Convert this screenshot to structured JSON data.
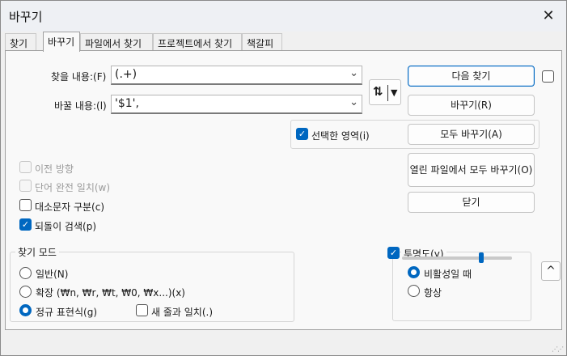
{
  "window": {
    "title": "바꾸기",
    "close_glyph": "✕"
  },
  "tabs": [
    {
      "label": "찾기"
    },
    {
      "label": "바꾸기"
    },
    {
      "label": "파일에서 찾기"
    },
    {
      "label": "프로젝트에서 찾기"
    },
    {
      "label": "책갈피"
    }
  ],
  "find": {
    "label": "찾을 내용:(F)",
    "value": "(.+)"
  },
  "replace": {
    "label": "바꿀 내용:(l)",
    "value": "'$1',"
  },
  "swap": {
    "glyph": "⇅",
    "caret": "▼"
  },
  "buttons": {
    "find_next": "다음 찾기",
    "replace": "바꾸기(R)",
    "replace_all": "모두 바꾸기(A)",
    "replace_all_open": "열린 파일에서 모두 바꾸기(O)",
    "close": "닫기"
  },
  "in_selection": {
    "label": "선택한 영역(i)",
    "checked": true
  },
  "options": {
    "backward": {
      "label": "이전 방향",
      "checked": false,
      "enabled": false
    },
    "whole_word": {
      "label": "단어 완전 일치(w)",
      "checked": false,
      "enabled": false
    },
    "match_case": {
      "label": "대소문자 구분(c)",
      "checked": false,
      "enabled": true
    },
    "wrap_around": {
      "label": "되돌이 검색(p)",
      "checked": true,
      "enabled": true
    }
  },
  "search_mode": {
    "title": "찾기 모드",
    "normal": "일반(N)",
    "extended": "확장 (₩n, ₩r, ₩t, ₩0, ₩x...)(x)",
    "regex": "정규 표현식(g)",
    "dot_newline": "새 줄과 일치(.)",
    "selected": "regex"
  },
  "transparency": {
    "label": "투명도(y)",
    "checked": true,
    "on_losing_focus": "비활성일 때",
    "always": "항상",
    "selected": "on_losing_focus",
    "level": 0.72
  },
  "collapse": {
    "glyph": "^"
  },
  "grip": "⋰⋰",
  "checkmark": "✓",
  "caret_down": "⌄",
  "colors": {
    "accent": "#0067c0",
    "background": "#f0f0f0",
    "panel": "#f9f9f9"
  }
}
